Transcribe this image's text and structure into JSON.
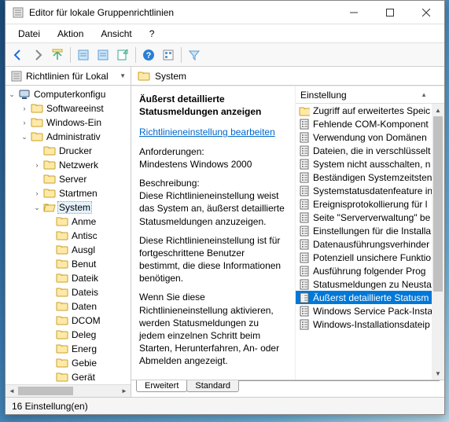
{
  "window": {
    "title": "Editor für lokale Gruppenrichtlinien"
  },
  "menu": {
    "file": "Datei",
    "action": "Aktion",
    "view": "Ansicht",
    "help": "?"
  },
  "tree": {
    "root": "Richtlinien für Lokal",
    "computerConfig": "Computerkonfigu",
    "software": "Softwareeinst",
    "windows": "Windows-Ein",
    "admin": "Administrativ",
    "drucker": "Drucker",
    "netzwerk": "Netzwerk",
    "server": "Server",
    "startmen": "Startmen",
    "system": "System",
    "anme": "Anme",
    "antisc": "Antisc",
    "ausgl": "Ausgl",
    "benut": "Benut",
    "dateik": "Dateik",
    "datei": "Dateis",
    "daten": "Daten",
    "dcom": "DCOM",
    "deleg": "Deleg",
    "energ": "Energ",
    "gebie": "Gebie",
    "gerat": "Gerät",
    "more": "..."
  },
  "rightHeader": "System",
  "desc": {
    "title": "Äußerst detaillierte Statusmeldungen anzeigen",
    "editLink": "Richtlinieneinstellung bearbeiten",
    "reqLabel": "Anforderungen:",
    "reqText": "Mindestens Windows 2000",
    "descLabel": "Beschreibung:",
    "descText1": "Diese Richtlinieneinstellung weist das System an, äußerst detaillierte Statusmeldungen anzuzeigen.",
    "descText2": "Diese Richtlinieneinstellung ist für fortgeschrittene Benutzer bestimmt, die diese Informationen benötigen.",
    "descText3": "Wenn Sie diese Richtlinieneinstellung aktivieren, werden Statusmeldungen zu jedem einzelnen Schritt beim Starten, Herunterfahren, An- oder Abmelden angezeigt."
  },
  "listHeader": "Einstellung",
  "list": {
    "items": [
      {
        "icon": "folder",
        "label": "Zugriff auf erweitertes Speic"
      },
      {
        "icon": "policy",
        "label": "Fehlende COM-Komponent"
      },
      {
        "icon": "policy",
        "label": "Verwendung von Domänen"
      },
      {
        "icon": "policy",
        "label": "Dateien, die in verschlüsselt"
      },
      {
        "icon": "policy",
        "label": "System nicht ausschalten, n"
      },
      {
        "icon": "policy",
        "label": "Beständigen Systemzeitsten"
      },
      {
        "icon": "policy",
        "label": "Systemstatusdatenfeature in"
      },
      {
        "icon": "policy",
        "label": "Ereignisprotokollierung für l"
      },
      {
        "icon": "policy",
        "label": "Seite \"Serververwaltung\" be"
      },
      {
        "icon": "policy",
        "label": "Einstellungen für die Installa"
      },
      {
        "icon": "policy",
        "label": "Datenausführungsverhinder"
      },
      {
        "icon": "policy",
        "label": "Potenziell unsichere Funktio"
      },
      {
        "icon": "policy",
        "label": "Ausführung folgender Prog"
      },
      {
        "icon": "policy",
        "label": "Statusmeldungen zu Neusta"
      },
      {
        "icon": "policy",
        "label": "Äußerst detaillierte Statusm",
        "selected": true
      },
      {
        "icon": "policy",
        "label": "Windows Service Pack-Insta"
      },
      {
        "icon": "policy",
        "label": "Windows-Installationsdateip"
      }
    ]
  },
  "tabs": {
    "extended": "Erweitert",
    "standard": "Standard"
  },
  "status": "16 Einstellung(en)"
}
